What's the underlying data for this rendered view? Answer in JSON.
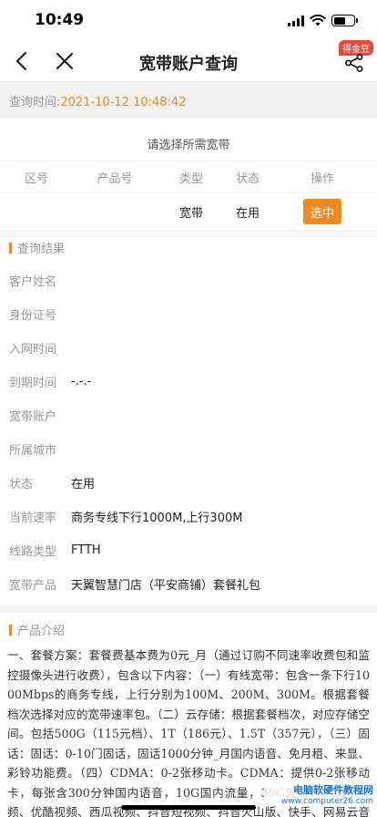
{
  "status_bar": {
    "time": "10:49"
  },
  "nav": {
    "title": "宽带账户查询",
    "badge": "得金豆"
  },
  "query": {
    "time_label": "查询时间:",
    "time_value": "2021-10-12 10:48:42"
  },
  "table": {
    "title": "请选择所需宽带",
    "headers": [
      "区号",
      "产品号",
      "类型",
      "状态",
      "操作"
    ],
    "row": {
      "area": "",
      "product_no": "",
      "type": "宽带",
      "status": "在用",
      "action": "选中"
    }
  },
  "result": {
    "title": "查询结果",
    "fields": [
      {
        "key": "客户姓名",
        "value": ""
      },
      {
        "key": "身份证号",
        "value": ""
      },
      {
        "key": "入网时间",
        "value": ""
      },
      {
        "key": "到期时间",
        "value": "-.-.-"
      },
      {
        "key": "宽带账户",
        "value": ""
      },
      {
        "key": "所属城市",
        "value": ""
      },
      {
        "key": "状态",
        "value": "在用"
      },
      {
        "key": "当前速率",
        "value": "商务专线下行1000M,上行300M"
      },
      {
        "key": "线路类型",
        "value": "FTTH"
      },
      {
        "key": "宽带产品",
        "value": "天翼智慧门店（平安商铺）套餐礼包"
      }
    ]
  },
  "intro": {
    "title": "产品介绍",
    "text": "一、套餐方案：套餐费基本费为0元_月（通过订购不同速率收费包和监控摄像头进行收费），包含以下内容：（一）有线宽带：包含一条下行1000Mbps的商务专线，上行分别为100M、200M、300M。根据套餐档次选择对应的宽带速率包。（二）云存储：根据套餐档次，对应存储空间。包括500G（115元档）、1T（186元）、1.5T（357元），（三）固话：固话：0-10门固话，固话1000分钟_月国内语音、免月租、来显、彩铃功能费。（四）CDMA：0-2张移动卡。CDMA：提供0-2张移动卡，每张含300分钟国内语音，10G国内流量，30G爱奇艺、腾讯视频、优酷视频、西瓜视频、抖音短视频、抖音火山版、快手、网易云音乐等应用定"
  },
  "watermark": {
    "main": "电脑软硬件教程网",
    "url": "www.computer26.com"
  }
}
